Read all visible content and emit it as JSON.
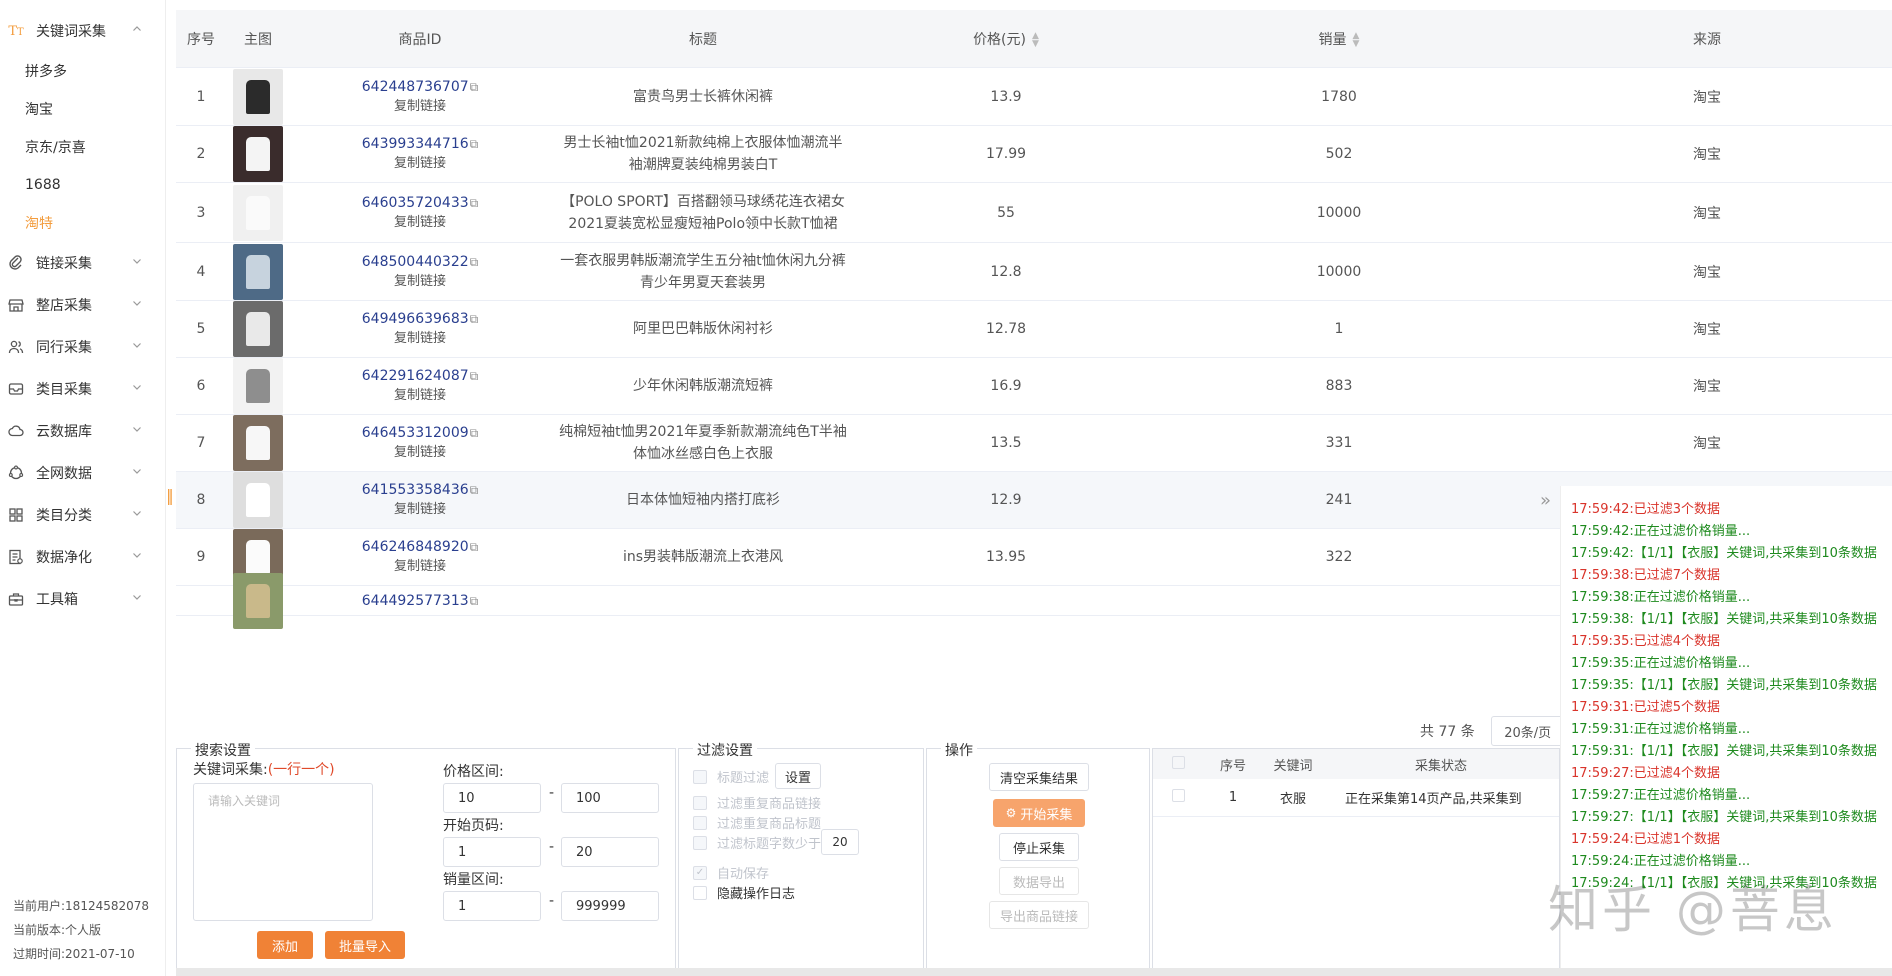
{
  "sidebar": {
    "groups": [
      {
        "label": "关键词采集",
        "icon": "text-icon",
        "expanded": true,
        "subs": [
          "拼多多",
          "淘宝",
          "京东/京喜",
          "1688",
          "淘特"
        ],
        "active_sub": 4
      },
      {
        "label": "链接采集",
        "icon": "paperclip-icon"
      },
      {
        "label": "整店采集",
        "icon": "store-icon"
      },
      {
        "label": "同行采集",
        "icon": "users-icon"
      },
      {
        "label": "类目采集",
        "icon": "inbox-icon"
      },
      {
        "label": "云数据库",
        "icon": "cloud-icon"
      },
      {
        "label": "全网数据",
        "icon": "globe-icon"
      },
      {
        "label": "类目分类",
        "icon": "grid-icon"
      },
      {
        "label": "数据净化",
        "icon": "filter-doc-icon"
      },
      {
        "label": "工具箱",
        "icon": "toolbox-icon"
      }
    ],
    "footer": {
      "user": "当前用户:18124582078",
      "version": "当前版本:个人版",
      "expire": "过期时间:2021-07-10"
    }
  },
  "table": {
    "headers": {
      "no": "序号",
      "img": "主图",
      "id": "商品ID",
      "title": "标题",
      "price": "价格(元)",
      "sales": "销量",
      "source": "来源"
    },
    "copy_label": "复制链接",
    "rows": [
      {
        "no": "1",
        "id": "642448736707",
        "title": "富贵鸟男士长裤休闲裤",
        "price": "13.9",
        "sales": "1780",
        "source": "淘宝",
        "img_color": "#2b2b2b",
        "img_bg": "#e8e8e8"
      },
      {
        "no": "2",
        "id": "643993344716",
        "title": "男士长袖t恤2021新款纯棉上衣服体恤潮流半袖潮牌夏装纯棉男装白T",
        "price": "17.99",
        "sales": "502",
        "source": "淘宝",
        "img_color": "#f4f4f4",
        "img_bg": "#3a2c2c"
      },
      {
        "no": "3",
        "id": "646035720433",
        "title": "【POLO SPORT】百搭翻领马球绣花连衣裙女2021夏装宽松显瘦短袖Polo领中长款T恤裙",
        "price": "55",
        "sales": "10000",
        "source": "淘宝",
        "img_color": "#fafafa",
        "img_bg": "#f0f0f0"
      },
      {
        "no": "4",
        "id": "648500440322",
        "title": "一套衣服男韩版潮流学生五分袖t恤休闲九分裤青少年男夏天套装男",
        "price": "12.8",
        "sales": "10000",
        "source": "淘宝",
        "img_color": "#c7d3de",
        "img_bg": "#4e6a86"
      },
      {
        "no": "5",
        "id": "649496639683",
        "title": "阿里巴巴韩版休闲衬衫",
        "price": "12.78",
        "sales": "1",
        "source": "淘宝",
        "img_color": "#e9e9e9",
        "img_bg": "#6b6b6b"
      },
      {
        "no": "6",
        "id": "642291624087",
        "title": "少年休闲韩版潮流短裤",
        "price": "16.9",
        "sales": "883",
        "source": "淘宝",
        "img_color": "#8e8e8e",
        "img_bg": "#f2f2f2"
      },
      {
        "no": "7",
        "id": "646453312009",
        "title": "纯棉短袖t恤男2021年夏季新款潮流纯色T半袖体恤冰丝感白色上衣服",
        "price": "13.5",
        "sales": "331",
        "source": "淘宝",
        "img_color": "#f7f7f7",
        "img_bg": "#7d6d5e"
      },
      {
        "no": "8",
        "id": "641553358436",
        "title": "日本体恤短袖内搭打底衫",
        "price": "12.9",
        "sales": "241",
        "source": "淘宝",
        "img_color": "#ffffff",
        "img_bg": "#dedede"
      },
      {
        "no": "9",
        "id": "646246848920",
        "title": "ins男装韩版潮流上衣港风",
        "price": "13.95",
        "sales": "322",
        "source": "淘宝",
        "img_color": "#fbfbfb",
        "img_bg": "#7a6a5a"
      },
      {
        "no": "",
        "id": "644492577313",
        "title": "",
        "price": "",
        "sales": "",
        "source": "",
        "img_color": "#c9b98a",
        "img_bg": "#8a9a6a"
      }
    ]
  },
  "pager": {
    "total": "共 77 条",
    "page_size": "20条/页"
  },
  "search": {
    "title": "搜索设置",
    "keyword_label": "关键词采集:",
    "keyword_hint": "(一行一个)",
    "keyword_placeholder": "请输入关键词",
    "price_label": "价格区间:",
    "price_min": "10",
    "price_max": "100",
    "page_label": "开始页码:",
    "page_min": "1",
    "page_max": "20",
    "sales_label": "销量区间:",
    "sales_min": "1",
    "sales_max": "999999",
    "add_btn": "添加",
    "import_btn": "批量导入"
  },
  "filter": {
    "title": "过滤设置",
    "title_filter": "标题过滤",
    "settings_btn": "设置",
    "dup_link": "过滤重复商品链接",
    "dup_title": "过滤重复商品标题",
    "min_chars": "过滤标题字数少于",
    "min_chars_value": "20",
    "autosave": "自动保存",
    "hide_log": "隐藏操作日志"
  },
  "ops": {
    "title": "操作",
    "clear": "清空采集结果",
    "start": "开始采集",
    "stop": "停止采集",
    "export": "数据导出",
    "export_links": "导出商品链接"
  },
  "status": {
    "headers": {
      "no": "序号",
      "kw": "关键词",
      "state": "采集状态"
    },
    "row": {
      "no": "1",
      "kw": "衣服",
      "state": "正在采集第14页产品,共采集到"
    }
  },
  "log": [
    {
      "t": "17:59:42:已过滤3个数据",
      "c": "r"
    },
    {
      "t": "17:59:42:正在过滤价格销量...",
      "c": "g"
    },
    {
      "t": "17:59:42:【1/1】【衣服】关键词,共采集到10条数据",
      "c": "g"
    },
    {
      "t": "17:59:38:已过滤7个数据",
      "c": "r"
    },
    {
      "t": "17:59:38:正在过滤价格销量...",
      "c": "g"
    },
    {
      "t": "17:59:38:【1/1】【衣服】关键词,共采集到10条数据",
      "c": "g"
    },
    {
      "t": "17:59:35:已过滤4个数据",
      "c": "r"
    },
    {
      "t": "17:59:35:正在过滤价格销量...",
      "c": "g"
    },
    {
      "t": "17:59:35:【1/1】【衣服】关键词,共采集到10条数据",
      "c": "g"
    },
    {
      "t": "17:59:31:已过滤5个数据",
      "c": "r"
    },
    {
      "t": "17:59:31:正在过滤价格销量...",
      "c": "g"
    },
    {
      "t": "17:59:31:【1/1】【衣服】关键词,共采集到10条数据",
      "c": "g"
    },
    {
      "t": "17:59:27:已过滤4个数据",
      "c": "r"
    },
    {
      "t": "17:59:27:正在过滤价格销量...",
      "c": "g"
    },
    {
      "t": "17:59:27:【1/1】【衣服】关键词,共采集到10条数据",
      "c": "g"
    },
    {
      "t": "17:59:24:已过滤1个数据",
      "c": "r"
    },
    {
      "t": "17:59:24:正在过滤价格销量...",
      "c": "g"
    },
    {
      "t": "17:59:24:【1/1】【衣服】关键词,共采集到10条数据",
      "c": "g"
    }
  ],
  "watermark": "知乎 @菩息"
}
